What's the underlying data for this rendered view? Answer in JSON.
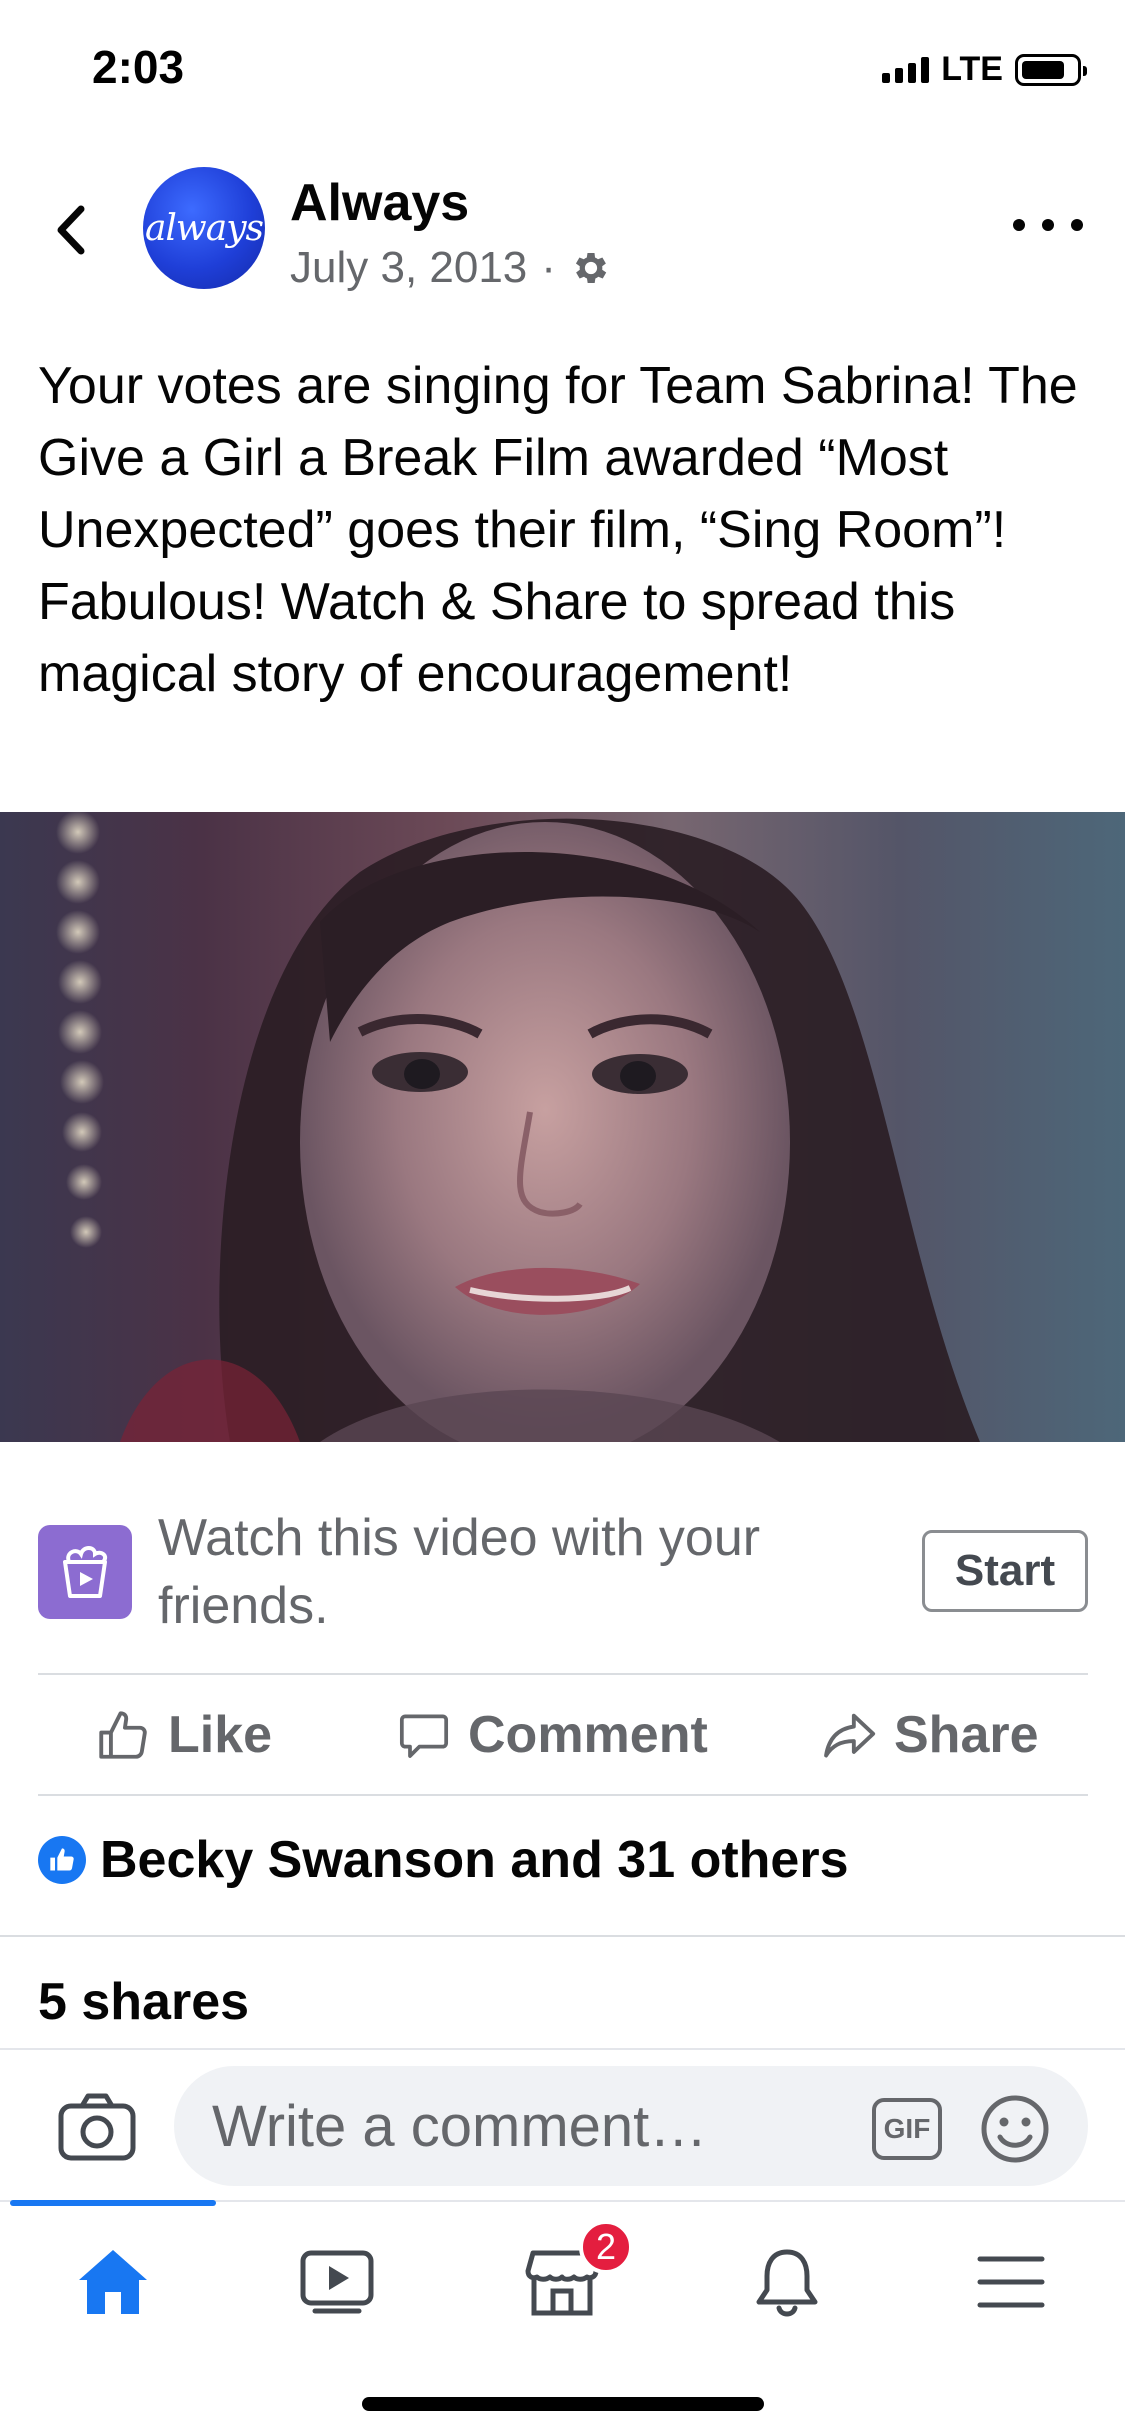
{
  "status_bar": {
    "time": "2:03",
    "network": "LTE"
  },
  "post": {
    "page_name": "Always",
    "avatar_logo_text": "always",
    "date": "July 3, 2013",
    "separator": "·",
    "privacy_icon": "gear-icon",
    "text": "Your votes are singing for Team Sabrina! The Give a Girl a Break Film awarded “Most Unexpected” goes their film, “Sing Room”! Fabulous! Watch & Share to spread this magical story of encouragement!"
  },
  "watch_party": {
    "text": "Watch this video with your friends.",
    "start_label": "Start"
  },
  "actions": {
    "like_label": "Like",
    "comment_label": "Comment",
    "share_label": "Share"
  },
  "engagement": {
    "reactions_text": "Becky Swanson and 31 others",
    "shares_text": "5 shares"
  },
  "comment_bar": {
    "placeholder": "Write a comment…",
    "gif_label": "GIF"
  },
  "bottom_nav": {
    "items": [
      {
        "icon": "home-icon",
        "active": true
      },
      {
        "icon": "video-icon",
        "active": false
      },
      {
        "icon": "marketplace-icon",
        "active": false,
        "badge": "2"
      },
      {
        "icon": "bell-icon",
        "active": false
      },
      {
        "icon": "menu-icon",
        "active": false
      }
    ]
  },
  "colors": {
    "accent": "#1877f2",
    "text_secondary": "#65676b",
    "badge_red": "#e41e3f",
    "watch_party_purple": "#8c6cd1"
  }
}
